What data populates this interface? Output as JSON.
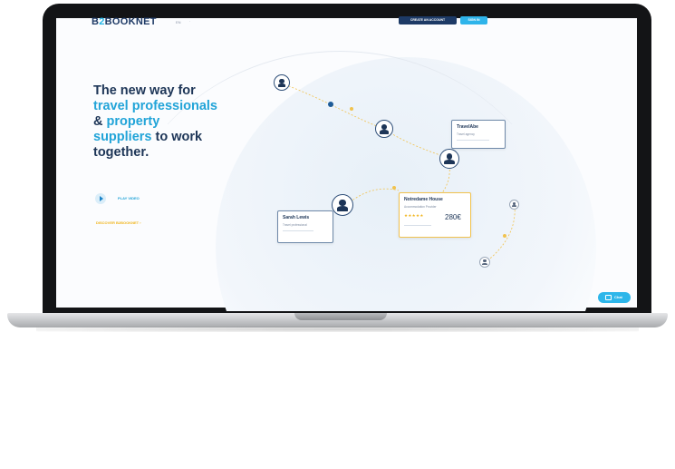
{
  "header": {
    "logo_prefix": "B",
    "logo_accent": "2",
    "logo_suffix": "BOOKNET",
    "lang": "EN",
    "lang_sep": "·",
    "nav_links": [
      "Search",
      "Help"
    ],
    "create_account": "CREATE AN ACCOUNT",
    "sign_in": "SIGN IN"
  },
  "hero": {
    "line1": "The new way for",
    "highlight1": "travel professionals",
    "amp": "& ",
    "highlight2": "property",
    "highlight3": "suppliers",
    "rest": " to work",
    "last": "together.",
    "play_label": "PLAY VIDEO",
    "discover": "DISCOVER B2BOOKNET ›"
  },
  "cards": {
    "travel": {
      "title": "TravelAbe",
      "sub": "Travel agency"
    },
    "hotel": {
      "title": "Notredame House",
      "sub": "Accommodation Provider",
      "stars": "★★★★★",
      "price": "280€"
    },
    "sarah": {
      "title": "Sarah Lewis",
      "sub": "Travel professional"
    }
  },
  "chat": {
    "label": "Chat"
  },
  "colors": {
    "navy": "#1d3557",
    "accent_blue": "#22a4d8",
    "yellow": "#f0b41a"
  }
}
